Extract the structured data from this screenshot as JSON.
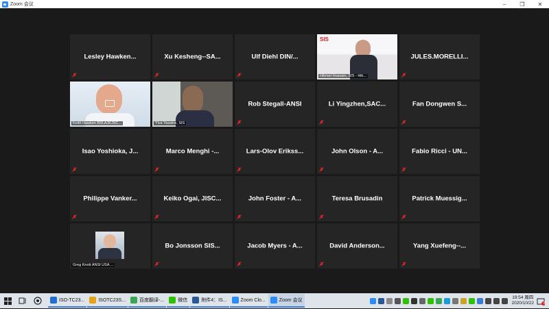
{
  "window": {
    "title": "Zoom 会议",
    "minimize": "–",
    "restore": "❐",
    "close": "✕"
  },
  "participants": [
    {
      "name": "Lesley Hawken..."
    },
    {
      "name": "Xu Kesheng--SA..."
    },
    {
      "name": "Ulf Diehl  DIN/..."
    },
    {
      "caption": "Hikmet Hussain, SIS - Hik...",
      "logo": "SIS"
    },
    {
      "name": "JULES.MORELLI..."
    },
    {
      "caption": "Keith Hawken BSI,AJKJSC..."
    },
    {
      "caption": "Ylva Yassine, SIS"
    },
    {
      "name": "Rob Stegall-ANSI"
    },
    {
      "name": "Li Yingzhen,SAC..."
    },
    {
      "name": "Fan Dongwen S..."
    },
    {
      "name": "Isao Yoshioka, J..."
    },
    {
      "name": "Marco Menghi -..."
    },
    {
      "name": "Lars-Olov Erikss..."
    },
    {
      "name": "John Olson - A..."
    },
    {
      "name": "Fabio Ricci - UN..."
    },
    {
      "name": "Philippe Vanker..."
    },
    {
      "name": "Keiko Ogai, JISC..."
    },
    {
      "name": "John Foster - A..."
    },
    {
      "name": "Teresa Brusadin"
    },
    {
      "name": "Patrick  Muessig..."
    },
    {
      "caption": "Greg Knott ANSI USA ..."
    },
    {
      "name": "Bo Jonsson SIS..."
    },
    {
      "name": "Jacob Myers - A..."
    },
    {
      "name": "David  Anderson..."
    },
    {
      "name": "Yang Xuefeng--..."
    }
  ],
  "taskbar": {
    "apps": [
      {
        "label": "ISO-TC23...",
        "color": "#1f6fd1"
      },
      {
        "label": "ISOTC23S...",
        "color": "#e3a21a"
      },
      {
        "label": "百度翻译-...",
        "color": "#3aa655"
      },
      {
        "label": "微信",
        "color": "#2dc100"
      },
      {
        "label": "附件4：IS...",
        "color": "#2b5797"
      },
      {
        "label": "Zoom Clo...",
        "color": "#2d8cff"
      },
      {
        "label": "Zoom 会议",
        "color": "#2d8cff"
      }
    ],
    "clock_time": "19:54 周四",
    "clock_date": "2020/10/22",
    "notification_count": "6"
  },
  "colors": {
    "mute_red": "#e02828",
    "active_outline": "#c8e13c",
    "tile_bg": "#252525"
  }
}
